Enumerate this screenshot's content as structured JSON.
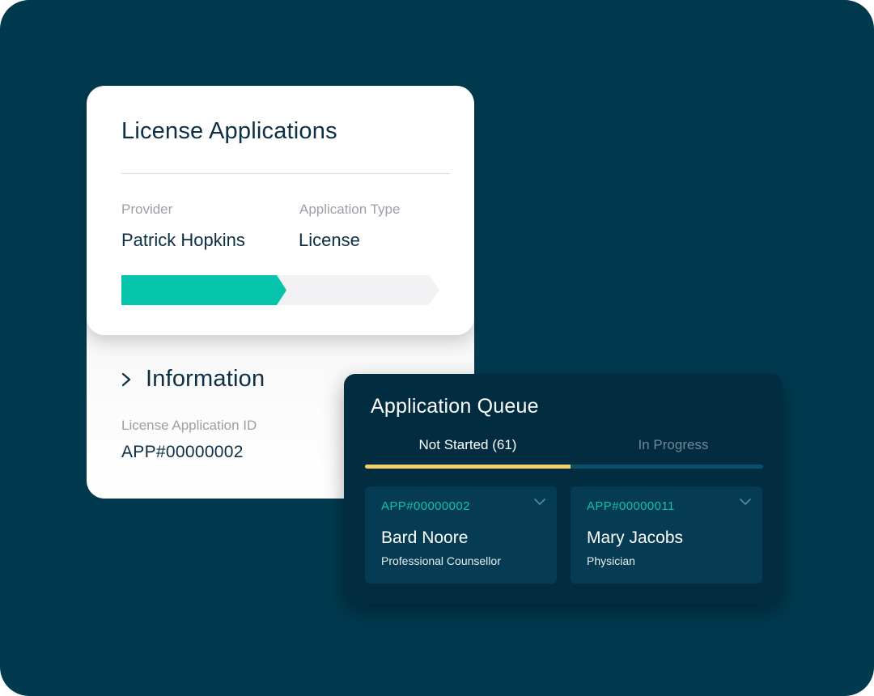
{
  "license_card": {
    "title": "License Applications",
    "provider_label": "Provider",
    "provider_value": "Patrick Hopkins",
    "type_label": "Application Type",
    "type_value": "License",
    "progress_fraction": 0.52,
    "progress_color": "#06c4a9"
  },
  "information": {
    "heading": "Information",
    "id_label": "License Application ID",
    "id_value": "APP#00000002"
  },
  "queue": {
    "title": "Application Queue",
    "tabs": [
      {
        "label": "Not Started (61)",
        "active": true
      },
      {
        "label": "In Progress",
        "active": false
      }
    ],
    "applications": [
      {
        "id": "APP#00000002",
        "name": "Bard Noore",
        "role": "Professional Counsellor"
      },
      {
        "id": "APP#00000011",
        "name": "Mary Jacobs",
        "role": "Physician"
      }
    ]
  },
  "colors": {
    "background": "#013a4f",
    "accent_teal": "#06c4a9",
    "tab_active": "#f5cf6a"
  }
}
